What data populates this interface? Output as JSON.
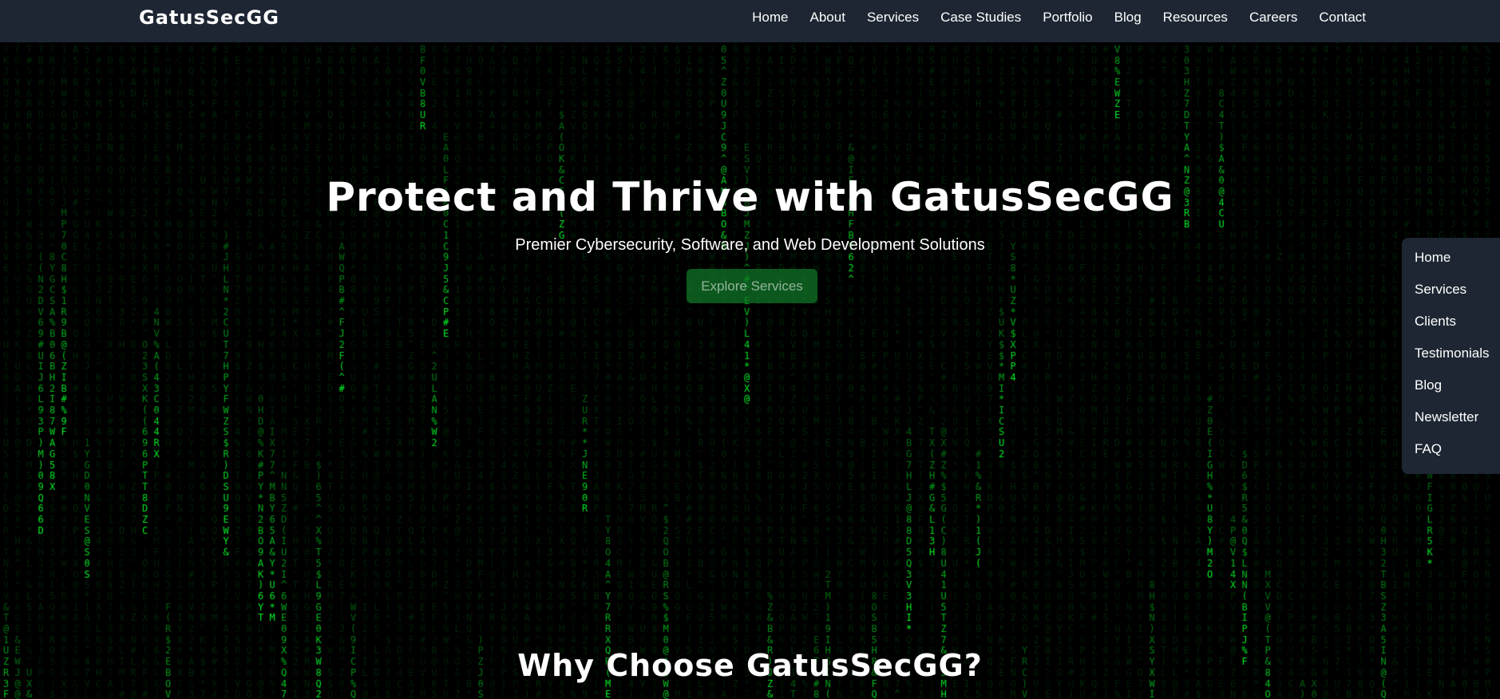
{
  "header": {
    "brand": "GatusSecGG",
    "nav": [
      "Home",
      "About",
      "Services",
      "Case Studies",
      "Portfolio",
      "Blog",
      "Resources",
      "Careers",
      "Contact"
    ]
  },
  "hero": {
    "title": "Protect and Thrive with GatusSecGG",
    "subtitle": "Premier Cybersecurity, Software, and Web Development Solutions",
    "cta_label": "Explore Services"
  },
  "side_nav": {
    "items": [
      "Home",
      "Services",
      "Clients",
      "Testimonials",
      "Blog",
      "Newsletter",
      "FAQ"
    ]
  },
  "section": {
    "title": "Why Choose GatusSecGG?"
  },
  "background": {
    "effect": "matrix-rain",
    "glyph_color": "#00ff2a",
    "base_color": "#000000"
  },
  "colors": {
    "nav_bg": "#1e2633",
    "cta_bg": "#107828",
    "text": "#ffffff"
  }
}
